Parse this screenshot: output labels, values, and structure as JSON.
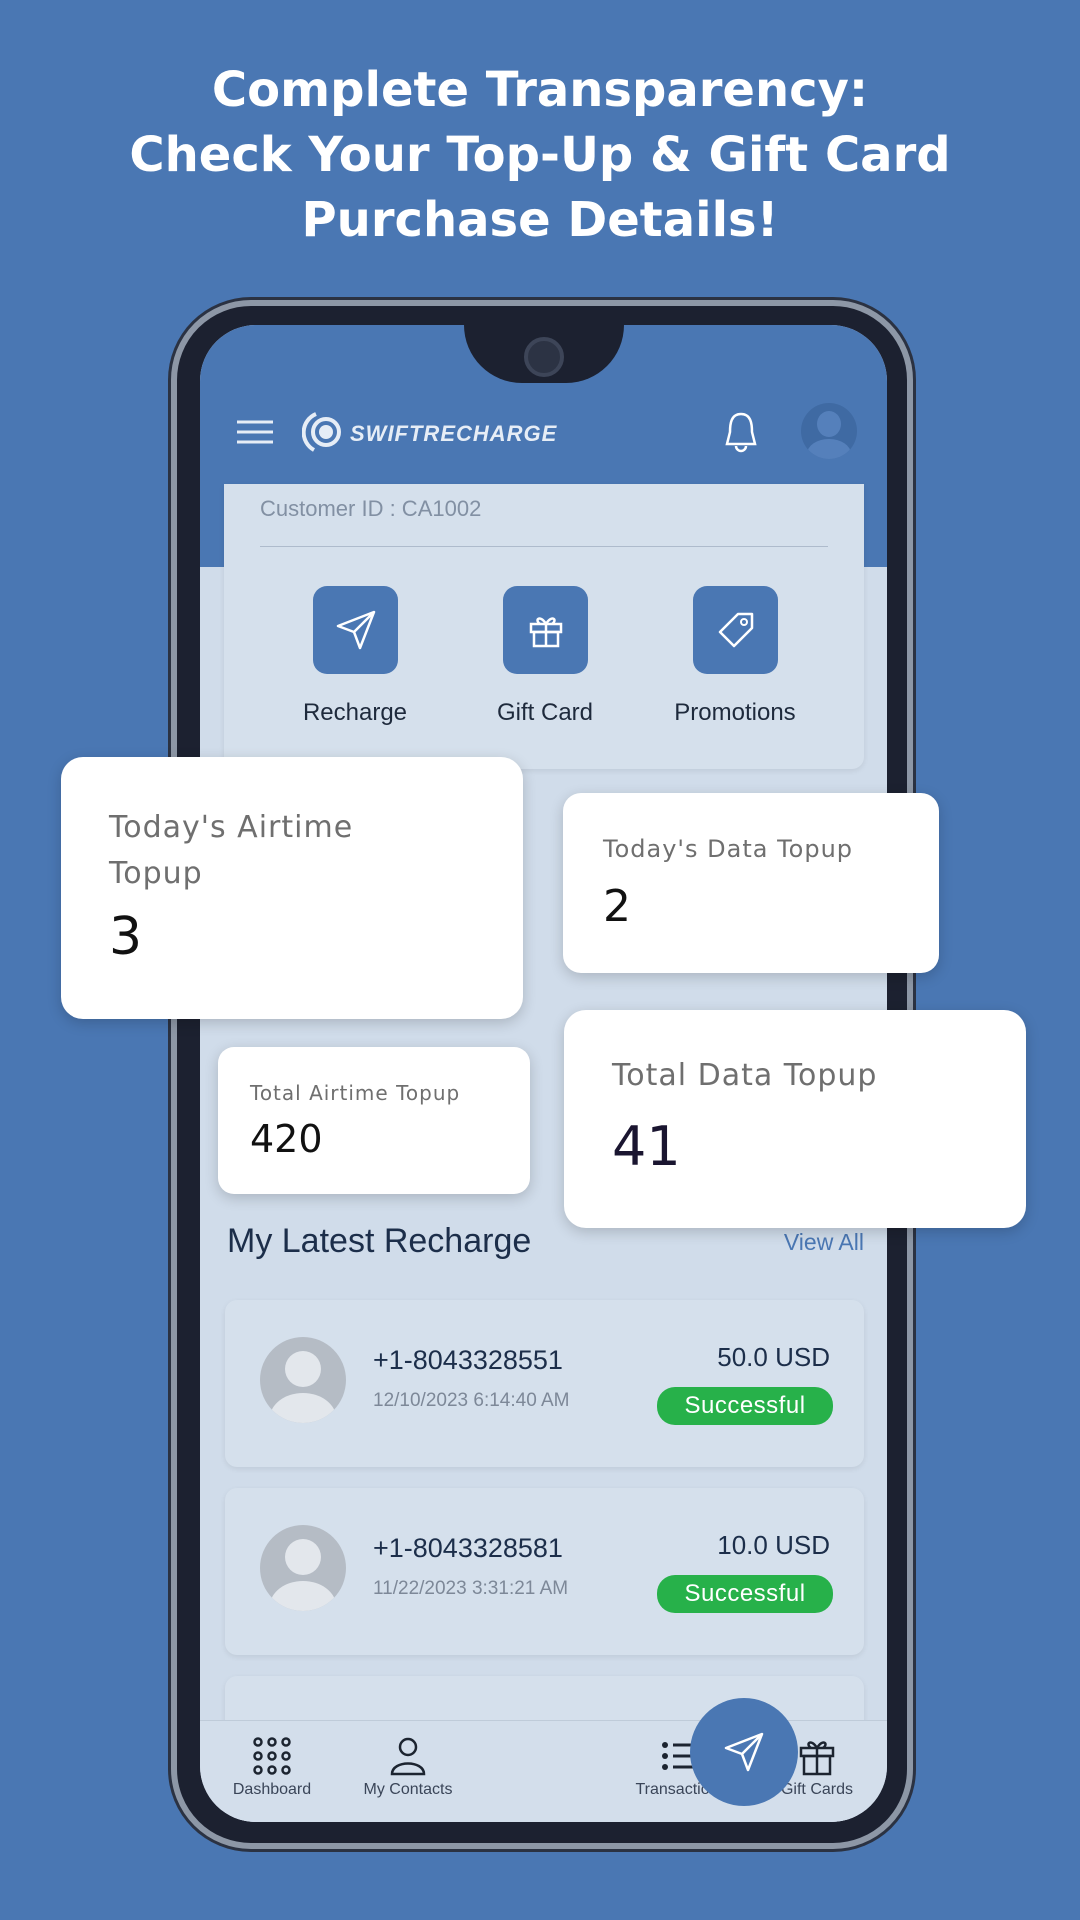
{
  "headline": {
    "line1": "Complete Transparency:",
    "line2": "Check Your Top-Up & Gift Card",
    "line3": "Purchase Details!"
  },
  "app": {
    "brand": "SWIFTRECHARGE",
    "customer_id": "Customer ID : CA1002"
  },
  "actions": [
    {
      "label": "Recharge",
      "icon": "send-icon"
    },
    {
      "label": "Gift Card",
      "icon": "gift-icon"
    },
    {
      "label": "Promotions",
      "icon": "tag-icon"
    }
  ],
  "stats": {
    "today_airtime": {
      "label_line1": "Today's Airtime",
      "label_line2": "Topup",
      "value": "3"
    },
    "today_data": {
      "label": "Today's Data Topup",
      "value": "2"
    },
    "total_airtime": {
      "label": "Total Airtime Topup",
      "value": "420"
    },
    "total_data": {
      "label": "Total Data Topup",
      "value": "41"
    }
  },
  "latest": {
    "title": "My Latest Recharge",
    "view_all": "View All",
    "items": [
      {
        "phone": "+1-8043328551",
        "date": "12/10/2023 6:14:40 AM",
        "amount": "50.0 USD",
        "status": "Successful"
      },
      {
        "phone": "+1-8043328581",
        "date": "11/22/2023 3:31:21 AM",
        "amount": "10.0 USD",
        "status": "Successful"
      }
    ]
  },
  "nav": [
    {
      "label": "Dashboard"
    },
    {
      "label": "My Contacts"
    },
    {
      "label": "Transactions"
    },
    {
      "label": "Gift Cards"
    }
  ],
  "colors": {
    "brand": "#4a77b3",
    "success": "#27b14a"
  }
}
